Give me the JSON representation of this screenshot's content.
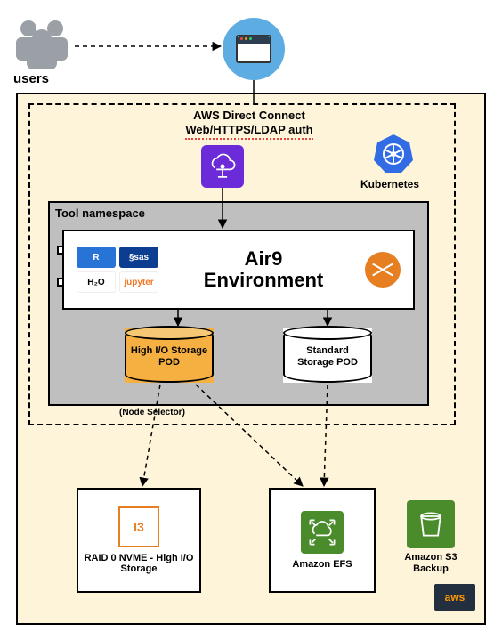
{
  "users": {
    "label": "users"
  },
  "connect": {
    "line1": "AWS  Direct Connect",
    "line2": "Web/HTTPS/LDAP auth"
  },
  "k8s": {
    "label": "Kubernetes"
  },
  "namespace": {
    "title": "Tool namespace"
  },
  "env": {
    "title_line1": "Air9",
    "title_line2": "Environment",
    "tools": {
      "r": "R",
      "sas": "§sas",
      "h2o": "H₂O",
      "jupyter": "jupyter"
    }
  },
  "pods": {
    "high": "High I/O Storage POD",
    "standard": "Standard Storage POD",
    "node_selector": "(Node Selector)"
  },
  "raid": {
    "chip": "I3",
    "label": "RAID 0 NVME - High I/O Storage"
  },
  "efs": {
    "label": "Amazon EFS"
  },
  "s3": {
    "label": "Amazon S3 Backup"
  },
  "aws_badge": "aws"
}
